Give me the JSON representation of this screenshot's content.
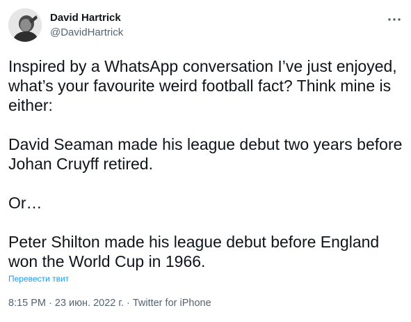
{
  "author": {
    "display_name": "David Hartrick",
    "handle": "@DavidHartrick",
    "avatar_icon": "user-avatar"
  },
  "more_icon": "more-horizontal-icon",
  "tweet": {
    "paragraphs": [
      "Inspired by a WhatsApp conversation I’ve just enjoyed, what’s your favourite weird football fact? Think mine is either:",
      "David Seaman made his league debut two years before Johan Cruyff retired.",
      "Or…",
      "Peter Shilton made his league debut before England won the World Cup in 1966."
    ]
  },
  "translate_label": "Перевести твит",
  "meta": {
    "time": "8:15 PM",
    "separator": " · ",
    "date": "23 июн. 2022 г.",
    "source": "Twitter for iPhone"
  },
  "colors": {
    "text": "#0f1419",
    "secondary": "#536471",
    "link": "#1d9bf0"
  }
}
